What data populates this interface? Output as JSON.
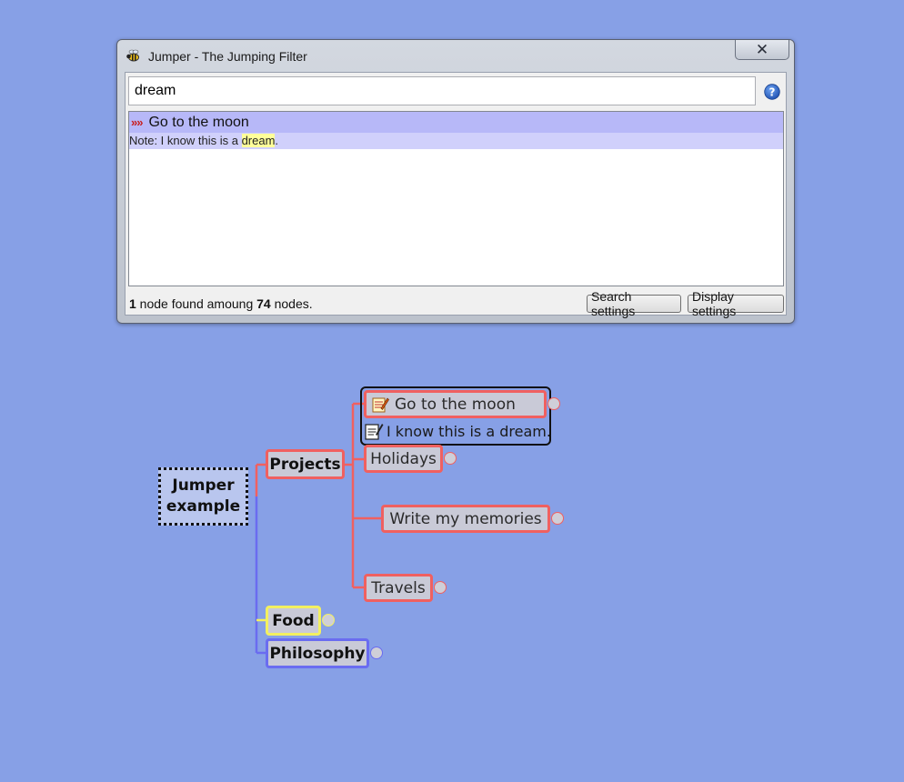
{
  "window": {
    "title": "Jumper - The Jumping Filter",
    "close_symbol": "✕",
    "icon": "bee-icon",
    "help_icon": "help-icon"
  },
  "search": {
    "value": "dream"
  },
  "results": [
    {
      "marker": "»»",
      "title": "Go to the moon",
      "note_prefix": "Note: I know this is a ",
      "note_match": "dream",
      "note_suffix": "."
    }
  ],
  "status": {
    "found": "1",
    "middle": " node found amoung ",
    "total": "74",
    "suffix": " nodes."
  },
  "buttons": {
    "search_settings": "Search settings",
    "display_settings": "Display settings"
  },
  "mindmap": {
    "root": {
      "line1": "Jumper",
      "line2": "example"
    },
    "projects": "Projects",
    "go_to_moon": "Go to the moon",
    "note": "I know this is a dream.",
    "holidays": "Holidays",
    "write_memories": "Write my memories",
    "travels": "Travels",
    "food": "Food",
    "philosophy": "Philosophy"
  },
  "colors": {
    "background": "#87a0e6",
    "red_branch": "#f06060",
    "yellow_branch": "#f3f060",
    "blue_branch": "#6a6cf0",
    "result_highlight": "#b7b8f8",
    "match_highlight": "#ffff99"
  }
}
